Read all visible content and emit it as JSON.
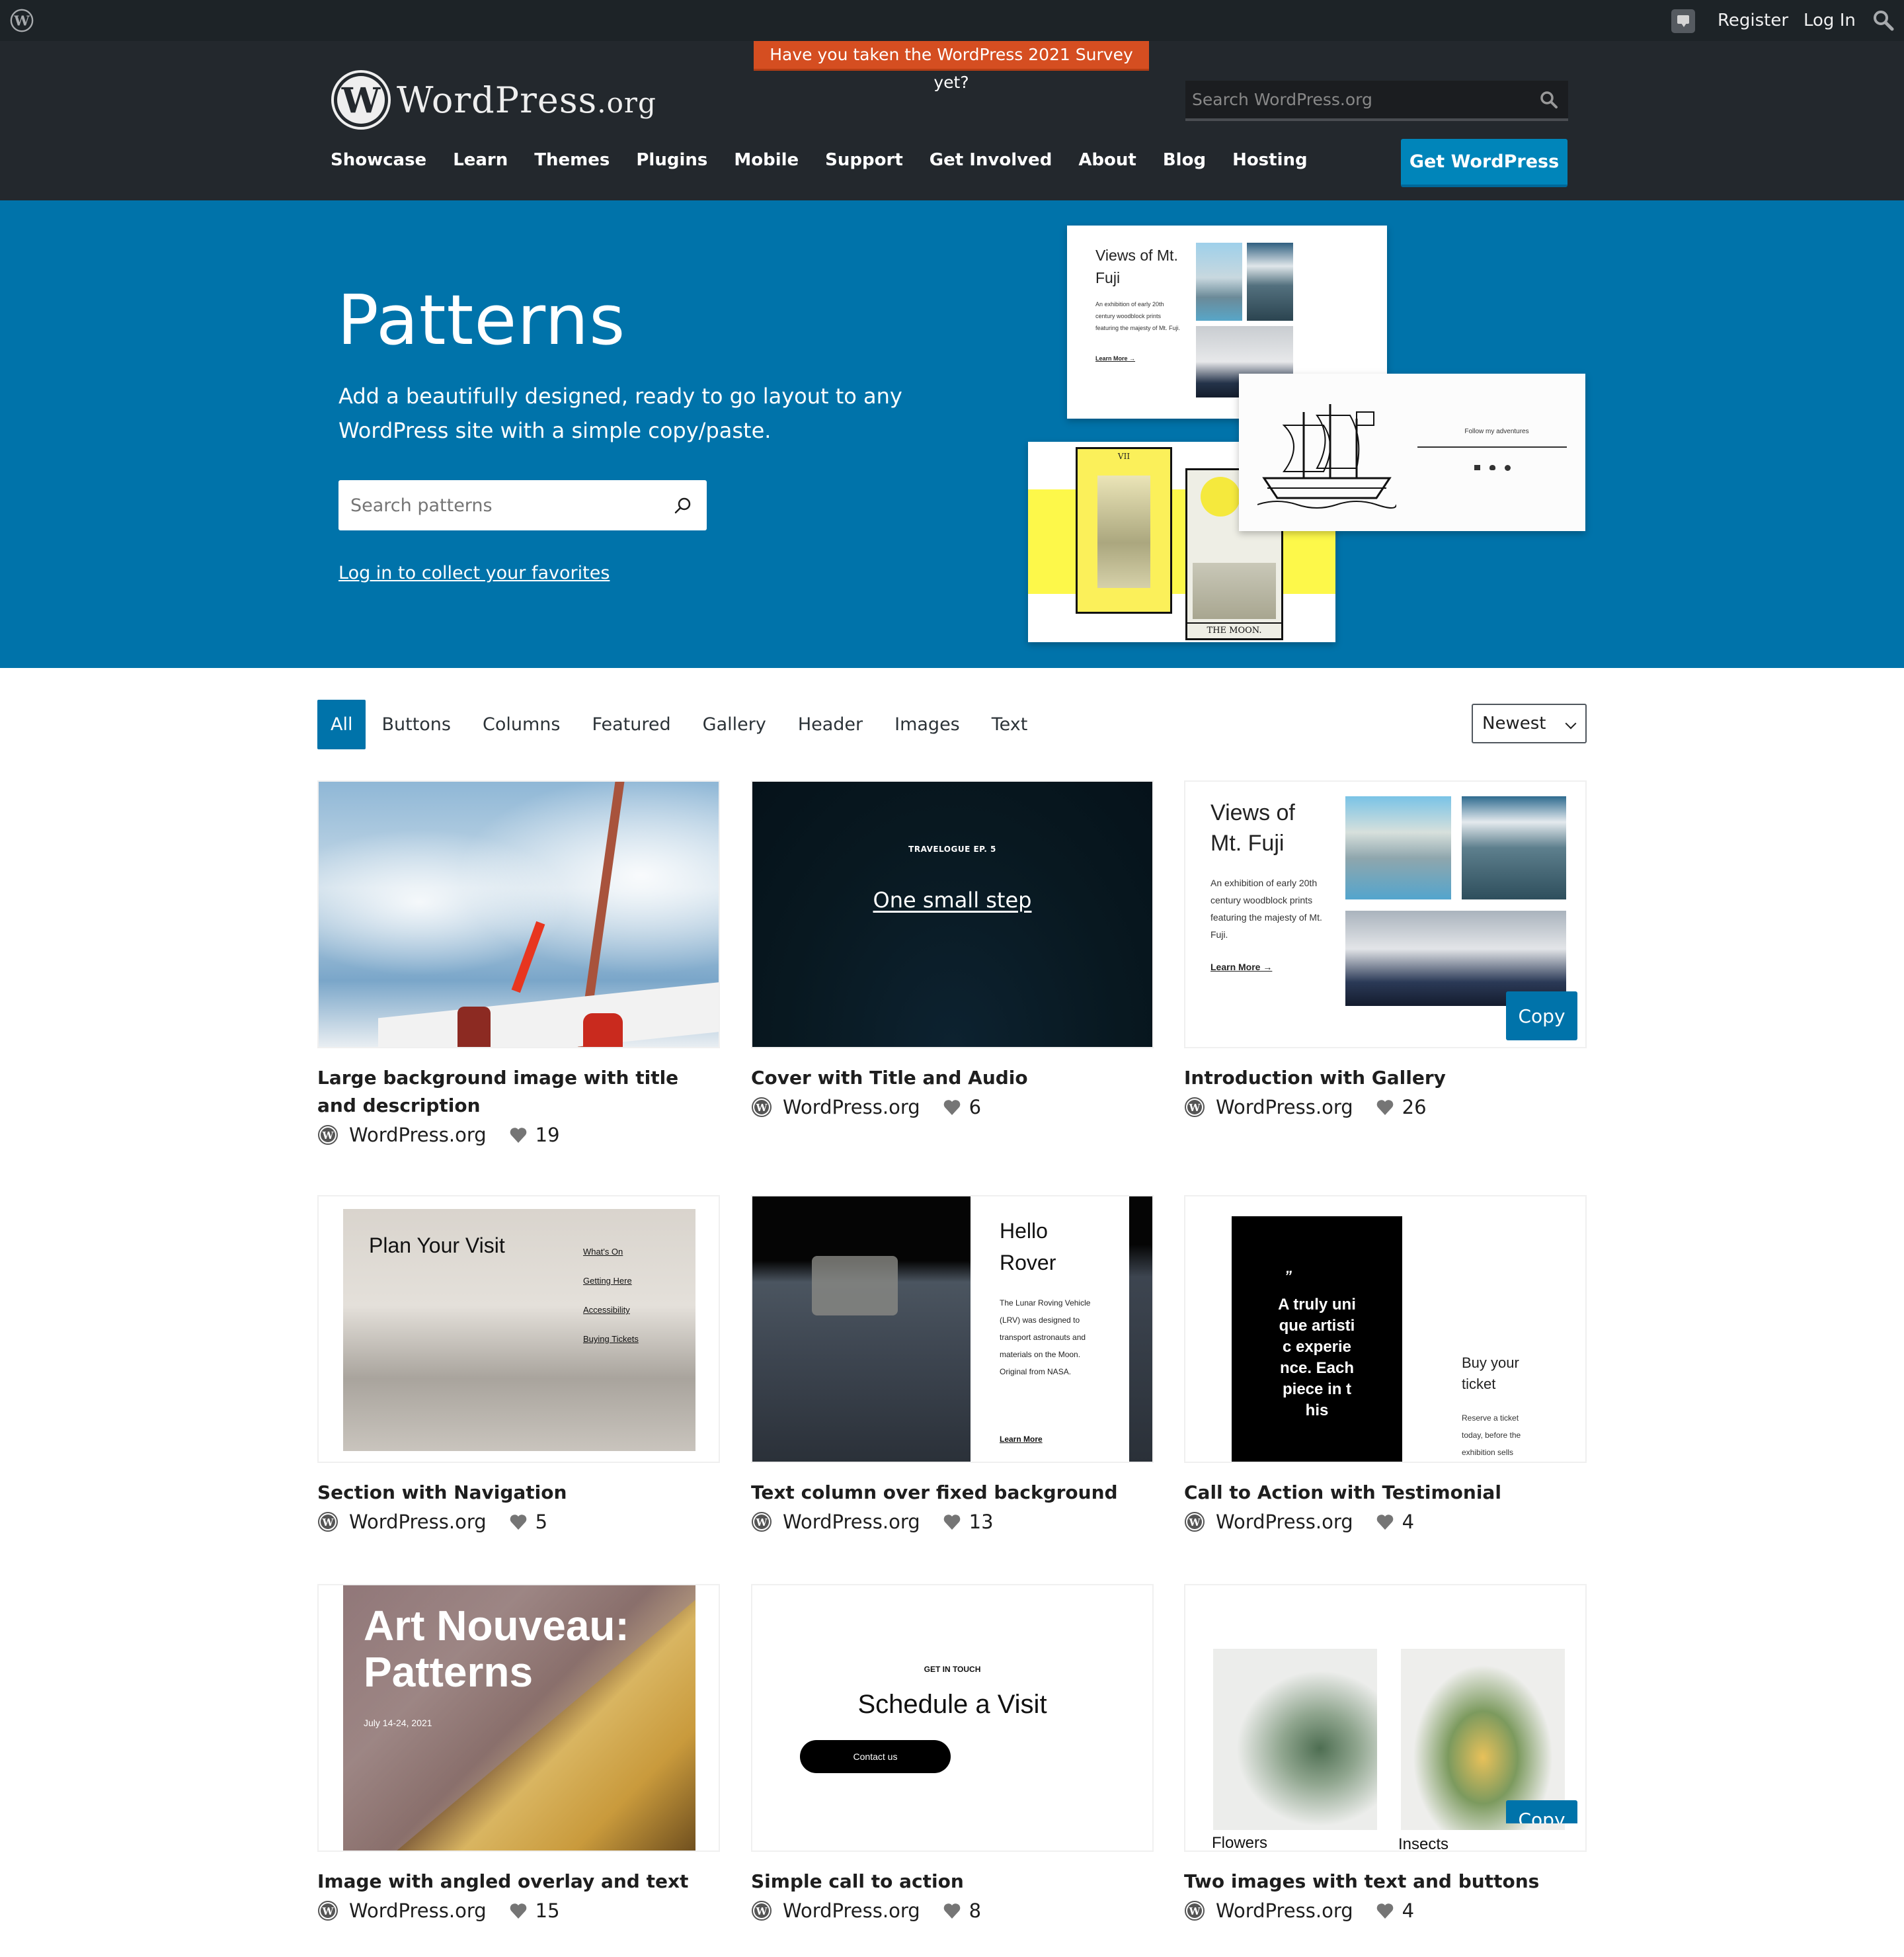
{
  "admin_bar": {
    "register": "Register",
    "login": "Log In"
  },
  "header": {
    "survey_banner": "Have you taken the WordPress 2021 Survey yet?",
    "logo_text_main": "WordPress",
    "logo_text_suffix": ".org",
    "search_placeholder": "Search WordPress.org",
    "nav": [
      "Showcase",
      "Learn",
      "Themes",
      "Plugins",
      "Mobile",
      "Support",
      "Get Involved",
      "About",
      "Blog",
      "Hosting"
    ],
    "get_wordpress": "Get WordPress"
  },
  "hero": {
    "title": "Patterns",
    "subtitle": "Add a beautifully designed, ready to go layout to any WordPress site with a simple copy/paste.",
    "search_placeholder": "Search patterns",
    "favorites_link": "Log in to collect your favorites",
    "collage": {
      "fuji_title": "Views of Mt. Fuji",
      "fuji_text": "An exhibition of early 20th century woodblock prints featuring the majesty of Mt. Fuji.",
      "fuji_link": "Learn More →",
      "ship_text": "Follow my adventures",
      "tarot_top": "VII",
      "tarot_moon": "THE MOON."
    }
  },
  "filters": {
    "categories": [
      "All",
      "Buttons",
      "Columns",
      "Featured",
      "Gallery",
      "Header",
      "Images",
      "Text"
    ],
    "active": "All",
    "sort_selected": "Newest"
  },
  "colors": {
    "accent": "#0073aa",
    "header_bg": "#23282d",
    "admin_bar_bg": "#1d2327",
    "survey_bg": "#d54e21"
  },
  "patterns": [
    {
      "title": "Large background image with title and description",
      "author": "WordPress.org",
      "likes": "19"
    },
    {
      "title": "Cover with Title and Audio",
      "author": "WordPress.org",
      "likes": "6",
      "preview": {
        "kicker": "TRAVELOGUE EP. 5",
        "heading": "One small step"
      }
    },
    {
      "title": "Introduction with Gallery",
      "author": "WordPress.org",
      "likes": "26",
      "copy_label": "Copy",
      "preview": {
        "heading": "Views of Mt. Fuji",
        "text": "An exhibition of early 20th century woodblock prints featuring the majesty of Mt. Fuji.",
        "link": "Learn More →"
      }
    },
    {
      "title": "Section with Navigation",
      "author": "WordPress.org",
      "likes": "5",
      "preview": {
        "heading": "Plan Your Visit",
        "links": [
          "What's On",
          "Getting Here",
          "Accessibility",
          "Buying Tickets"
        ]
      }
    },
    {
      "title": "Text column over fixed background",
      "author": "WordPress.org",
      "likes": "13",
      "preview": {
        "heading": "Hello Rover",
        "text": "The Lunar Roving Vehicle (LRV) was designed to transport astronauts and materials on the Moon. Original from NASA.",
        "link": "Learn More"
      }
    },
    {
      "title": "Call to Action with Testimonial",
      "author": "WordPress.org",
      "likes": "4",
      "preview": {
        "quote_mark": "”",
        "quote": "A truly unique artistic experience. Each piece in this",
        "heading": "Buy your ticket",
        "text": "Reserve a ticket today, before the exhibition sells"
      }
    },
    {
      "title": "Image with angled overlay and text",
      "author": "WordPress.org",
      "likes": "15",
      "preview": {
        "heading": "Art Nouveau: Patterns",
        "date": "July 14-24, 2021"
      }
    },
    {
      "title": "Simple call to action",
      "author": "WordPress.org",
      "likes": "8",
      "preview": {
        "kicker": "GET IN TOUCH",
        "heading": "Schedule a Visit",
        "button": "Contact us"
      }
    },
    {
      "title": "Two images with text and buttons",
      "author": "WordPress.org",
      "likes": "4",
      "copy_label": "Copy",
      "preview": {
        "caption_left": "Flowers",
        "caption_right": "Insects"
      }
    }
  ]
}
